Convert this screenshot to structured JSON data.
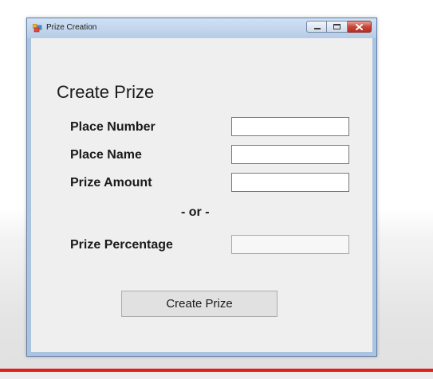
{
  "window": {
    "title": "Prize Creation",
    "controls": {
      "minimize_icon": "minimize-icon",
      "maximize_icon": "maximize-icon",
      "close_icon": "close-icon"
    }
  },
  "form": {
    "heading": "Create Prize",
    "fields": [
      {
        "label": "Place Number",
        "value": ""
      },
      {
        "label": "Place Name",
        "value": ""
      },
      {
        "label": "Prize Amount",
        "value": ""
      },
      {
        "label": "Prize Percentage",
        "value": ""
      }
    ],
    "separator": "- or -",
    "submit_label": "Create Prize"
  },
  "colors": {
    "client_background": "#efefef",
    "title_bar": "#c4d8ee",
    "close_button": "#c8463a",
    "accent_line": "#e0201c"
  }
}
